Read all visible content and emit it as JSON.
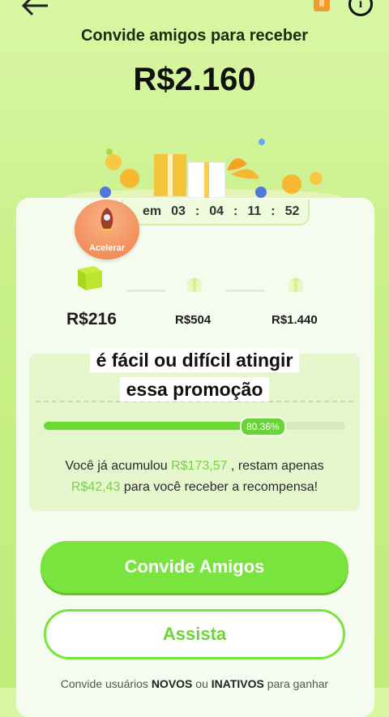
{
  "header": {
    "subtitle": "Convide amigos para receber",
    "amount": "R$2.160"
  },
  "timer": {
    "prefix": "em",
    "hours": "03",
    "minutes": "04",
    "seconds": "11",
    "centis": "52",
    "separator": ":"
  },
  "accelerate": {
    "label": "Acelerar"
  },
  "milestones": [
    {
      "value": "R$216"
    },
    {
      "value": "R$504"
    },
    {
      "value": "R$1.440"
    }
  ],
  "overlay": {
    "line1": "é fácil ou difícil atingir",
    "line2": "essa promoção"
  },
  "progress": {
    "percent_label": "80.36%",
    "percent": 80.36,
    "text_before": "Você já acumulou ",
    "accumulated": "R$173,57",
    "text_middle": " , restam apenas",
    "remaining": "R$42,43",
    "text_after": " para você receber a recompensa!"
  },
  "buttons": {
    "invite_label": "Convide Amigos",
    "watch_label": "Assista"
  },
  "footer": {
    "part1": "Convide usuários ",
    "bold1": "NOVOS",
    "part2": " ou ",
    "bold2": "INATIVOS",
    "part3": " para ganhar"
  },
  "colors": {
    "accent": "#7ae43e",
    "highlight": "#7ccf4a",
    "accelerate": "#f28f5a"
  },
  "icons": {
    "back": "arrow-left-icon",
    "info": "info-icon",
    "gift": "gift-box-icon",
    "rocket": "rocket-icon"
  }
}
